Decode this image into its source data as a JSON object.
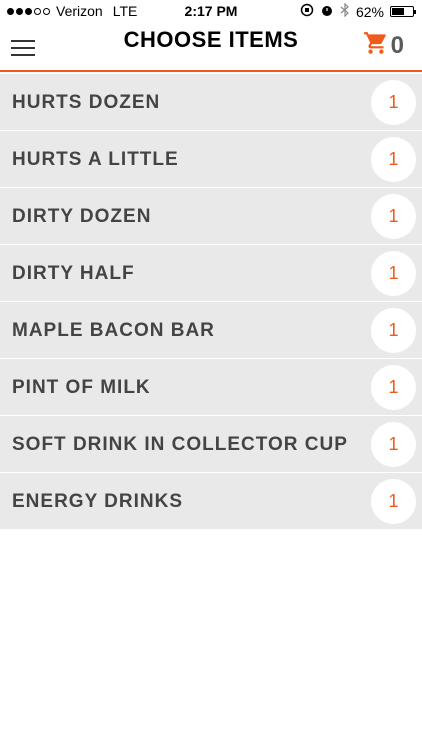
{
  "status_bar": {
    "carrier": "Verizon",
    "network": "LTE",
    "time": "2:17 PM",
    "battery_percent": "62%",
    "battery_level": 0.62,
    "signal_dots_filled": 3,
    "signal_dots_total": 5
  },
  "header": {
    "title": "CHOOSE ITEMS",
    "cart_count": "0",
    "accent_color": "#f05a1a"
  },
  "items": [
    {
      "name": "HURTS DOZEN",
      "quantity": "1"
    },
    {
      "name": "HURTS A LITTLE",
      "quantity": "1"
    },
    {
      "name": "DIRTY DOZEN",
      "quantity": "1"
    },
    {
      "name": "DIRTY HALF",
      "quantity": "1"
    },
    {
      "name": "MAPLE BACON BAR",
      "quantity": "1"
    },
    {
      "name": "PINT OF MILK",
      "quantity": "1"
    },
    {
      "name": "SOFT DRINK IN COLLECTOR CUP",
      "quantity": "1"
    },
    {
      "name": "ENERGY DRINKS",
      "quantity": "1"
    }
  ],
  "icons": {
    "menu": "hamburger-icon",
    "cart": "cart-icon",
    "rotation_lock": "rotation-lock-icon",
    "alarm": "alarm-icon",
    "bluetooth": "bluetooth-icon",
    "battery": "battery-icon"
  }
}
